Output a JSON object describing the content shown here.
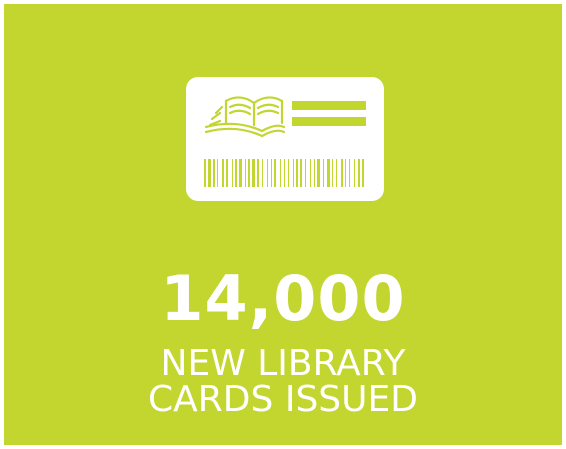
{
  "colors": {
    "background": "#c3d52f",
    "foreground": "#ffffff"
  },
  "icon": {
    "name": "library-card-icon"
  },
  "stat": {
    "value": "14,000",
    "label_line1": "NEW LIBRARY",
    "label_line2": "CARDS ISSUED"
  }
}
